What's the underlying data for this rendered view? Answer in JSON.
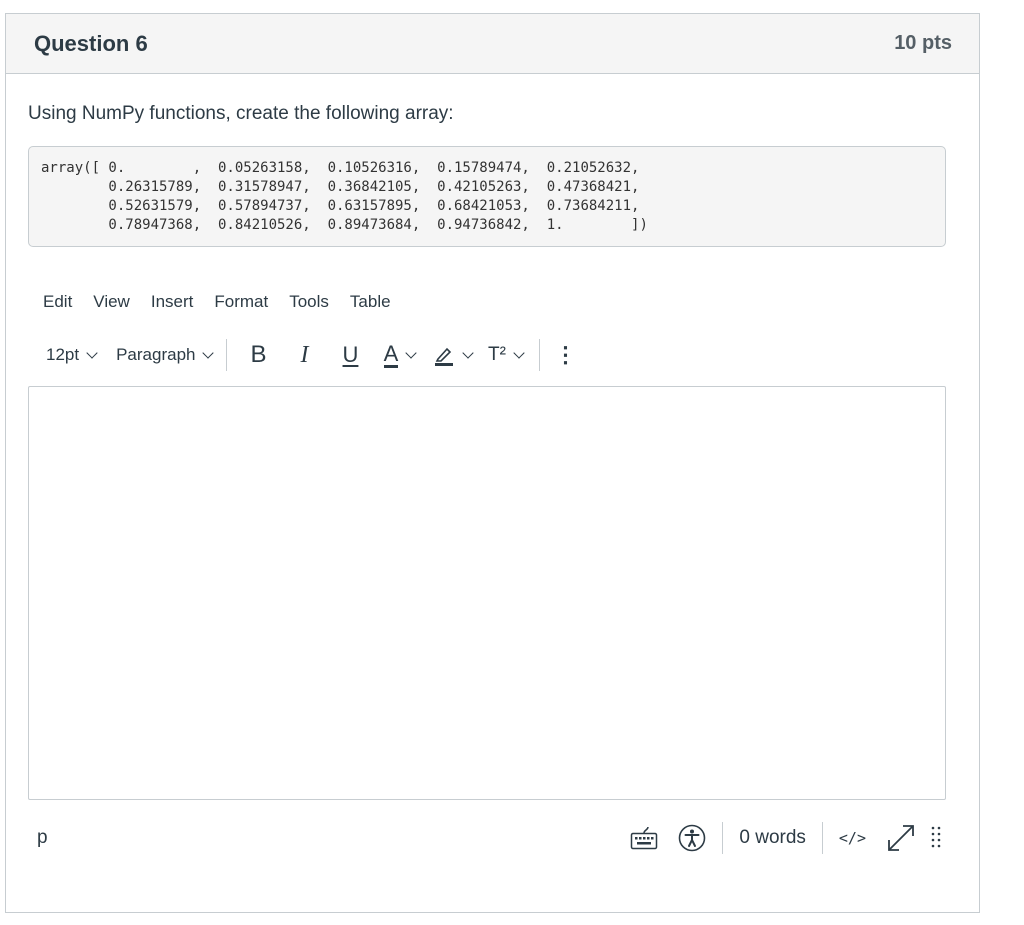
{
  "question": {
    "title": "Question 6",
    "points": "10 pts",
    "prompt": "Using NumPy functions, create the following array:",
    "code": "array([ 0.        ,  0.05263158,  0.10526316,  0.15789474,  0.21052632,\n        0.26315789,  0.31578947,  0.36842105,  0.42105263,  0.47368421,\n        0.52631579,  0.57894737,  0.63157895,  0.68421053,  0.73684211,\n        0.78947368,  0.84210526,  0.89473684,  0.94736842,  1.        ])"
  },
  "menubar": {
    "items": [
      "Edit",
      "View",
      "Insert",
      "Format",
      "Tools",
      "Table"
    ]
  },
  "toolbar": {
    "font_size": "12pt",
    "block_format": "Paragraph",
    "bold": "B",
    "italic": "I",
    "underline": "U",
    "text_color_glyph": "A",
    "superscript": "T²",
    "more": "⋮"
  },
  "statusbar": {
    "path": "p",
    "word_count": "0 words",
    "html_view": "</>"
  },
  "icons": {
    "keyboard": "keyboard-icon",
    "accessibility": "accessibility-icon",
    "fullscreen": "fullscreen-icon",
    "resize": "resize-handle-icon"
  },
  "colors": {
    "text": "#2d3b45",
    "header_bg": "#f5f5f5",
    "border": "#c7cdd1"
  }
}
